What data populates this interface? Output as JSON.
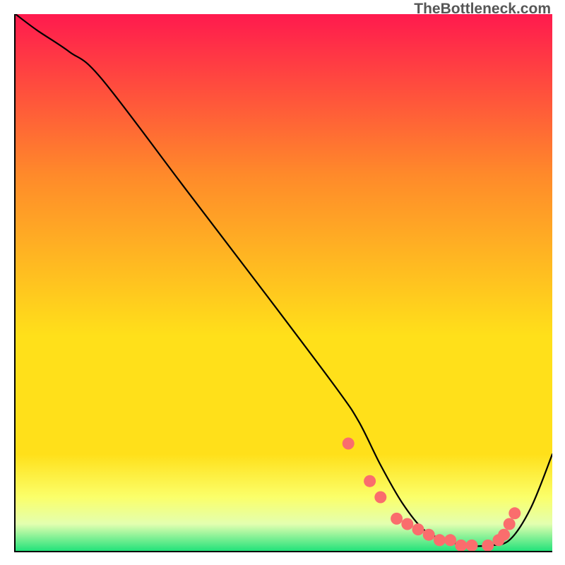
{
  "watermark": "TheBottleneck.com",
  "colors": {
    "top": "#ff1a4e",
    "upper_mid": "#ff8a2a",
    "mid": "#ffe01a",
    "lower_band1": "#fbff6a",
    "lower_band2": "#e3ffb0",
    "bottom": "#23e27a",
    "curve": "#000000",
    "dots": "#fa6d6d",
    "dots_stroke": "#e65959"
  },
  "chart_data": {
    "type": "line",
    "title": "",
    "xlabel": "",
    "ylabel": "",
    "xlim": [
      0,
      100
    ],
    "ylim": [
      0,
      100
    ],
    "series": [
      {
        "name": "curve",
        "x": [
          0,
          4,
          10,
          16,
          32,
          48,
          60,
          64,
          68,
          72,
          76,
          80,
          84,
          88,
          92,
          96,
          100
        ],
        "y": [
          100,
          97,
          93,
          88,
          67,
          46,
          30,
          24,
          16,
          9,
          4,
          2,
          1,
          1,
          2,
          8,
          18
        ]
      }
    ],
    "dots": {
      "x": [
        62,
        66,
        68,
        71,
        73,
        75,
        77,
        79,
        81,
        83,
        85,
        88,
        90,
        91,
        92,
        93
      ],
      "y": [
        20,
        13,
        10,
        6,
        5,
        4,
        3,
        2,
        2,
        1,
        1,
        1,
        2,
        3,
        5,
        7
      ]
    }
  }
}
